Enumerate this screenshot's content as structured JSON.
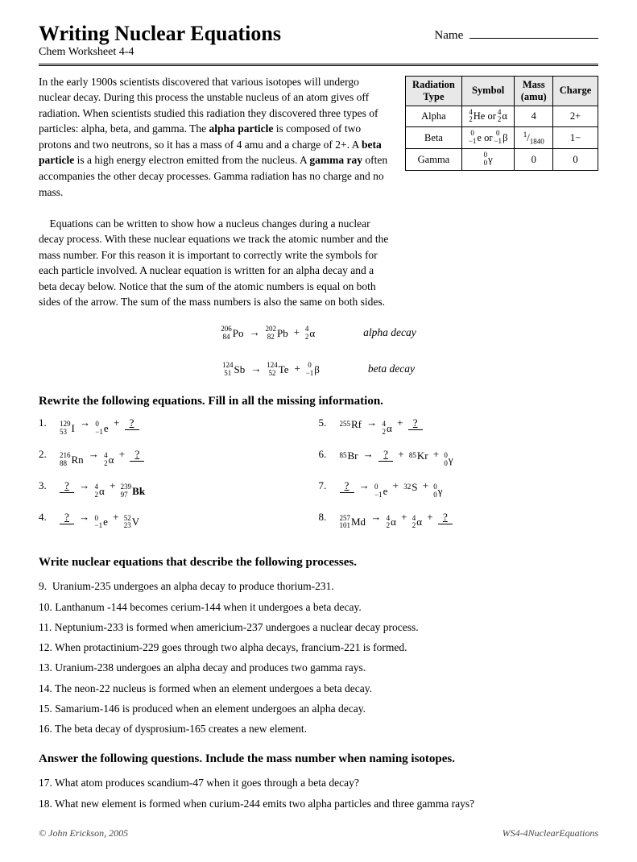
{
  "header": {
    "title": "Writing Nuclear Equations",
    "subtitle": "Chem Worksheet 4-4",
    "name_label": "Name",
    "name_line": "___________________"
  },
  "intro": {
    "paragraph1": "In the early 1900s scientists discovered that various isotopes will undergo nuclear decay. During this process the unstable nucleus of an atom gives off radiation. When scientists studied this radiation they discovered three types of particles: alpha, beta, and gamma. The ",
    "alpha_bold": "alpha particle",
    "paragraph2": " is composed of two protons and two neutrons, so it has a mass of 4 amu and a charge of 2+. A ",
    "beta_bold": "beta particle",
    "paragraph3": " is a high energy electron emitted from the nucleus. A ",
    "gamma_bold": "gamma ray",
    "paragraph4": " often accompanies the other decay processes. Gamma radiation has no charge and no mass.",
    "paragraph5": "Equations can be written to show how a nucleus changes during a nuclear decay process. With these nuclear equations we track the atomic number and the mass number. For this reason it is important to correctly write the symbols for each particle involved. A nuclear equation is written for an alpha decay and a beta decay below. Notice that the sum of the atomic numbers is equal on both sides of the arrow. The sum of the mass numbers is also the same on both sides."
  },
  "table": {
    "headers": [
      "Radiation Type",
      "Symbol",
      "Mass (amu)",
      "Charge"
    ],
    "rows": [
      {
        "type": "Alpha",
        "symbol": "⁴₂He or ⁴₂α",
        "mass": "4",
        "charge": "2+"
      },
      {
        "type": "Beta",
        "symbol": "⁰₋₁e or ⁰₋₁β",
        "mass": "1/1840",
        "charge": "1−"
      },
      {
        "type": "Gamma",
        "symbol": "⁰₀γ",
        "mass": "0",
        "charge": "0"
      }
    ]
  },
  "section1_heading": "Rewrite the following equations. Fill in all the missing information.",
  "section2_heading": "Write nuclear equations that describe the following processes.",
  "section3_heading": "Answer the following questions. Include the mass number when naming isotopes.",
  "word_problems": [
    "9.  Uranium-235 undergoes an alpha decay to produce thorium-231.",
    "10. Lanthanum -144 becomes cerium-144 when it undergoes a beta decay.",
    "11. Neptunium-233 is formed when americium-237 undergoes a nuclear decay process.",
    "12. When protactinium-229 goes through two alpha decays, francium-221 is formed.",
    "13. Uranium-238 undergoes an alpha decay and produces two gamma rays.",
    "14. The neon-22 nucleus is formed when an element undergoes a beta decay.",
    "15. Samarium-146 is produced when an element undergoes an alpha decay.",
    "16. The beta decay of dysprosium-165 creates a new element."
  ],
  "answer_questions": [
    "17. What atom produces scandium-47 when it goes through a beta decay?",
    "18. What new element is formed when curium-244 emits two alpha particles and three gamma rays?"
  ],
  "footer": {
    "left": "© John Erickson, 2005",
    "right": "WS4-4NuclearEquations"
  }
}
